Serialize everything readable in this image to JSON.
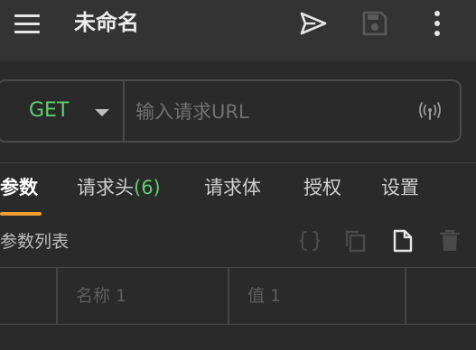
{
  "header": {
    "title": "未命名",
    "icons": [
      "menu-icon",
      "send-icon",
      "save-icon",
      "more-vertical-icon"
    ]
  },
  "request": {
    "method": "GET",
    "url_placeholder": "输入请求URL",
    "url_value": ""
  },
  "tabs": [
    {
      "label": "参数",
      "active": true
    },
    {
      "label": "请求头",
      "count": "(6)"
    },
    {
      "label": "请求体"
    },
    {
      "label": "授权"
    },
    {
      "label": "设置"
    }
  ],
  "params": {
    "section_label": "参数列表",
    "actions": [
      "json-braces-icon",
      "copy-icon",
      "file-icon",
      "trash-icon"
    ],
    "row": {
      "name_placeholder": "名称 1",
      "value_placeholder": "值 1"
    }
  },
  "colors": {
    "background": "#2a2a2a",
    "topbar": "#333333",
    "method_green": "#5fcf6f",
    "tab_underline": "#f0a030"
  }
}
